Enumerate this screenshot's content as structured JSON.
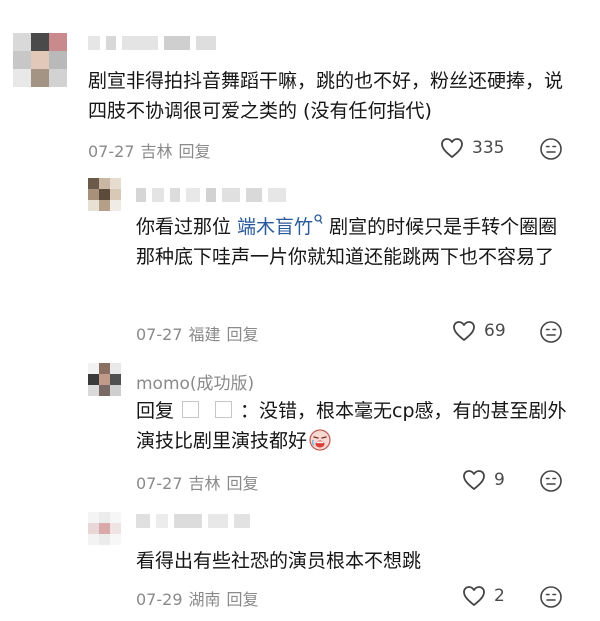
{
  "comments": [
    {
      "text": "剧宣非得拍抖音舞蹈干嘛，跳的也不好，粉丝还硬捧，说四肢不协调很可爱之类的 (没有任何指代)",
      "date": "07-27",
      "location": "吉林",
      "reply_label": "回复",
      "likes": "335"
    },
    {
      "text_before": "你看过那位 ",
      "mention": "端木盲竹",
      "mention_icon": "search-icon",
      "text_after": " 剧宣的时候只是手转个圈圈那种底下哇声一片你就知道还能跳两下也不容易了",
      "date": "07-27",
      "location": "福建",
      "reply_label": "回复",
      "likes": "69"
    },
    {
      "username": "momo(成功版)",
      "reply_prefix": "回复",
      "reply_sep": "：",
      "text": "没错，根本毫无cp感，有的甚至剧外演技比剧里演技都好",
      "emoji": "crying-face-emoji",
      "date": "07-27",
      "location": "吉林",
      "reply_label": "回复",
      "likes": "9"
    },
    {
      "text": "看得出有些社恐的演员根本不想跳",
      "date": "07-29",
      "location": "湖南",
      "reply_label": "回复",
      "likes": "2"
    }
  ],
  "colors": {
    "text": "#161616",
    "meta": "#8a8a8a",
    "mention": "#2a5b9c"
  },
  "icons": {
    "like": "heart-outline-icon",
    "emoji": "emoji-face-icon"
  }
}
